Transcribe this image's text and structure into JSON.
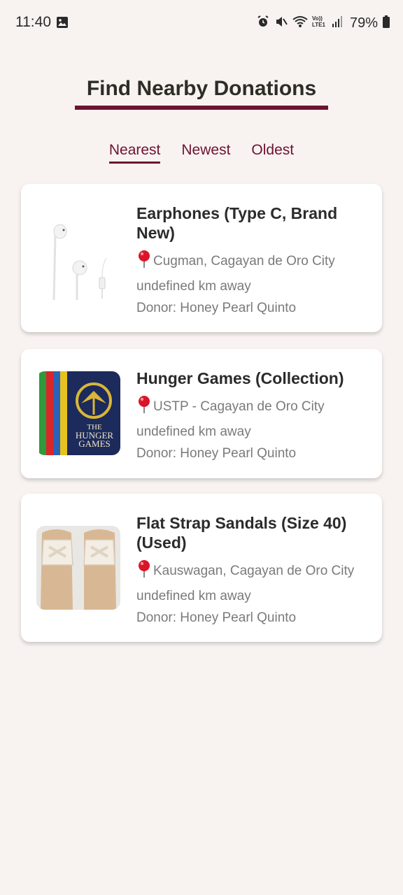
{
  "status_bar": {
    "time": "11:40",
    "battery": "79%",
    "icons": [
      "gallery-icon",
      "alarm-icon",
      "mute-icon",
      "wifi-icon",
      "volte-icon",
      "signal-icon",
      "battery-icon"
    ]
  },
  "header": {
    "title": "Find Nearby Donations"
  },
  "tabs": [
    {
      "label": "Nearest",
      "active": true
    },
    {
      "label": "Newest",
      "active": false
    },
    {
      "label": "Oldest",
      "active": false
    }
  ],
  "donations": [
    {
      "title": "Earphones (Type C, Brand New)",
      "location": "Cugman, Cagayan de Oro City",
      "distance": "undefined km away",
      "donor": "Donor: Honey Pearl Quinto",
      "image": "earphones-image"
    },
    {
      "title": "Hunger Games (Collection)",
      "location": "USTP - Cagayan de Oro City",
      "distance": "undefined km away",
      "donor": "Donor: Honey Pearl Quinto",
      "image": "book-collection-image",
      "image_text": [
        "THE",
        "HUNGER",
        "GAMES"
      ]
    },
    {
      "title": "Flat Strap Sandals (Size 40) (Used)",
      "location": "Kauswagan, Cagayan de Oro City",
      "distance": "undefined km away",
      "donor": "Donor: Honey Pearl Quinto",
      "image": "sandals-image"
    }
  ],
  "colors": {
    "accent": "#6e1231",
    "background": "#f8f3f1",
    "card": "#ffffff",
    "title_text": "#2d2d25",
    "muted_text": "#7a7a7a"
  }
}
